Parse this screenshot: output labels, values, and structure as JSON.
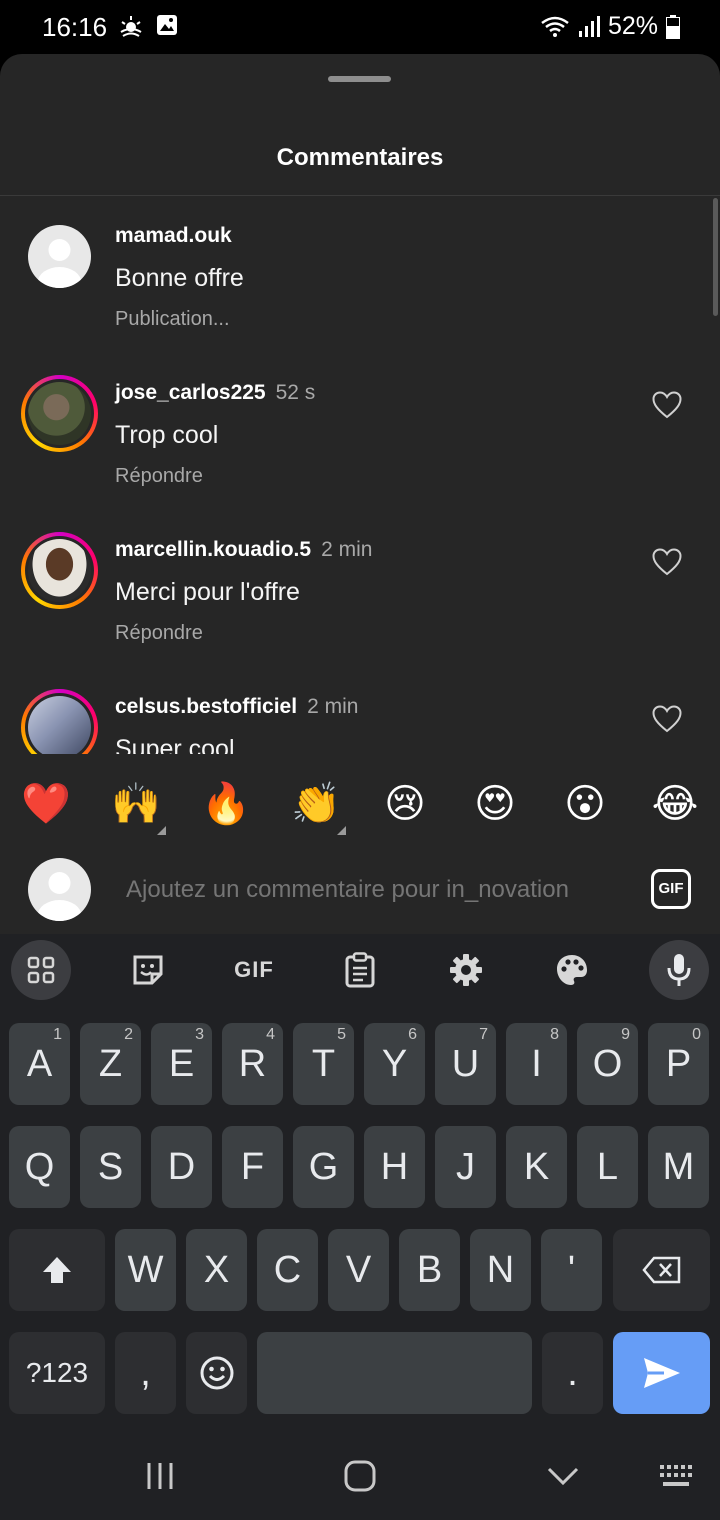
{
  "status_bar": {
    "time": "16:16",
    "battery": "52%"
  },
  "sheet": {
    "title": "Commentaires"
  },
  "comments": [
    {
      "username": "mamad.ouk",
      "time": "",
      "text": "Bonne offre",
      "meta": "Publication..."
    },
    {
      "username": "jose_carlos225",
      "time": "52 s",
      "text": "Trop cool",
      "meta": "Répondre"
    },
    {
      "username": "marcellin.kouadio.5",
      "time": "2 min",
      "text": "Merci pour l'offre",
      "meta": "Répondre"
    },
    {
      "username": "celsus.bestofficiel",
      "time": "2 min",
      "text": "Super cool",
      "meta": ""
    }
  ],
  "emoji_bar": [
    "❤️",
    "🙌",
    "🔥",
    "👏",
    "😢",
    "😍",
    "😮",
    "😂"
  ],
  "composer": {
    "placeholder": "Ajoutez un commentaire pour in_novation",
    "gif_label": "GIF"
  },
  "keyboard": {
    "toolbar_gif": "GIF",
    "row1": [
      {
        "key": "A",
        "hint": "1"
      },
      {
        "key": "Z",
        "hint": "2"
      },
      {
        "key": "E",
        "hint": "3"
      },
      {
        "key": "R",
        "hint": "4"
      },
      {
        "key": "T",
        "hint": "5"
      },
      {
        "key": "Y",
        "hint": "6"
      },
      {
        "key": "U",
        "hint": "7"
      },
      {
        "key": "I",
        "hint": "8"
      },
      {
        "key": "O",
        "hint": "9"
      },
      {
        "key": "P",
        "hint": "0"
      }
    ],
    "row2": [
      "Q",
      "S",
      "D",
      "F",
      "G",
      "H",
      "J",
      "K",
      "L",
      "M"
    ],
    "row3": [
      "W",
      "X",
      "C",
      "V",
      "B",
      "N",
      "'"
    ],
    "row4": {
      "symbols": "?123",
      "comma": ",",
      "period": "."
    }
  },
  "colors": {
    "sheet_bg": "#262626",
    "keyboard_bg": "#202124",
    "key_bg": "#3c4043",
    "send_key": "#669df6"
  }
}
